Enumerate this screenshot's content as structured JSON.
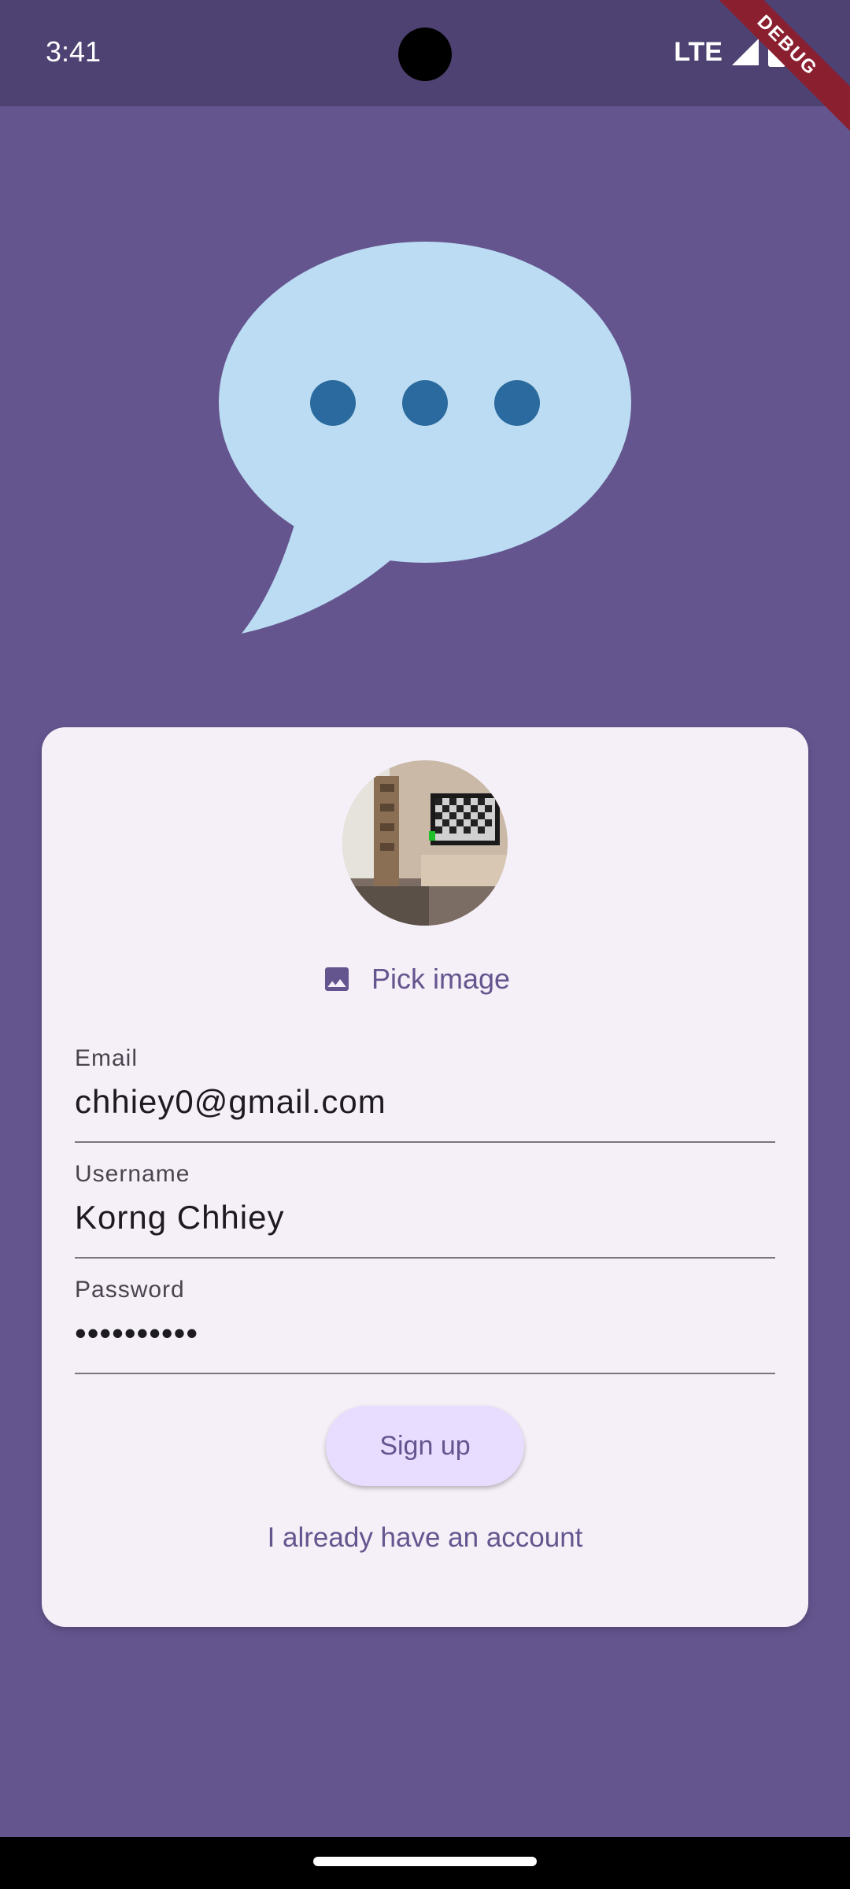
{
  "status_bar": {
    "time": "3:41",
    "network": "LTE",
    "icons": [
      "signal-icon",
      "battery-icon"
    ]
  },
  "debug_banner": "DEBUG",
  "logo": {
    "icon": "chat-bubble-icon",
    "colors": {
      "bubble": "#bbdcf2",
      "dots": "#2b6a9e"
    }
  },
  "form": {
    "pick_image_label": "Pick image",
    "email": {
      "label": "Email",
      "value": "chhiey0@gmail.com"
    },
    "username": {
      "label": "Username",
      "value": "Korng Chhiey"
    },
    "password": {
      "label": "Password",
      "value": "••••••••••"
    },
    "signup_label": "Sign up",
    "login_link": "I already have an account"
  },
  "colors": {
    "background": "#65558f",
    "card": "#f5eff7",
    "primary": "#65558f",
    "button": "#e8ddff"
  }
}
